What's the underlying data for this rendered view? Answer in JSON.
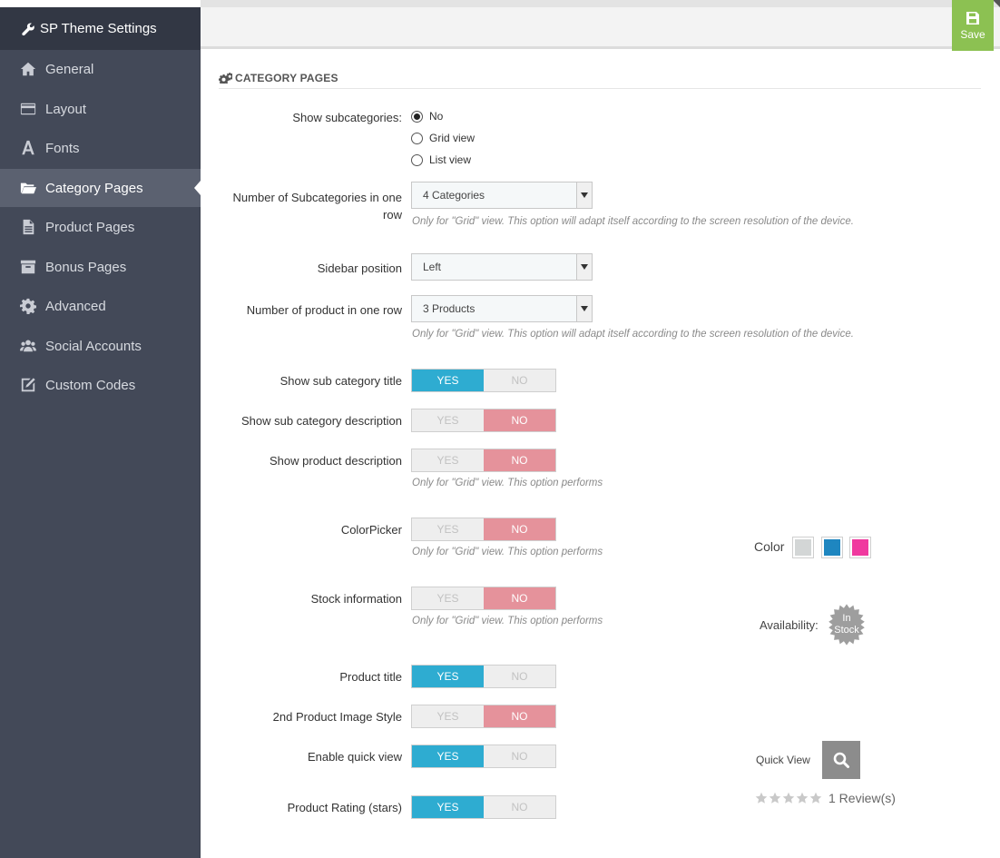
{
  "sidebar": {
    "title": "SP Theme Settings",
    "items": [
      {
        "label": "General",
        "icon": "home-icon"
      },
      {
        "label": "Layout",
        "icon": "credit-card-icon"
      },
      {
        "label": "Fonts",
        "icon": "font-icon"
      },
      {
        "label": "Category Pages",
        "icon": "folder-open-icon",
        "active": true
      },
      {
        "label": "Product Pages",
        "icon": "file-text-icon"
      },
      {
        "label": "Bonus Pages",
        "icon": "archive-icon"
      },
      {
        "label": "Advanced",
        "icon": "gear-icon"
      },
      {
        "label": "Social Accounts",
        "icon": "users-icon"
      },
      {
        "label": "Custom Codes",
        "icon": "edit-icon"
      }
    ]
  },
  "toolbar": {
    "save_label": "Save",
    "accent": "#8cc152"
  },
  "section": {
    "title": "CATEGORY PAGES"
  },
  "form": {
    "show_subcategories": {
      "label": "Show subcategories:",
      "options": [
        "No",
        "Grid view",
        "List view"
      ],
      "selected": "No"
    },
    "num_subcategories": {
      "label": "Number of Subcategories in one row",
      "value": "4 Categories",
      "hint": "Only for \"Grid\" view. This option will adapt itself according to the screen resolution of the device."
    },
    "sidebar_position": {
      "label": "Sidebar position",
      "value": "Left"
    },
    "num_products": {
      "label": "Number of product in one row",
      "value": "3 Products",
      "hint": "Only for \"Grid\" view. This option will adapt itself according to the screen resolution of the device."
    },
    "toggles_text": {
      "yes": "YES",
      "no": "NO"
    },
    "show_subcat_title": {
      "label": "Show sub category title",
      "value": "YES"
    },
    "show_subcat_desc": {
      "label": "Show sub category description",
      "value": "NO"
    },
    "show_product_desc": {
      "label": "Show product description",
      "value": "NO",
      "hint": "Only for \"Grid\" view. This option performs"
    },
    "colorpicker": {
      "label": "ColorPicker",
      "value": "NO",
      "hint": "Only for \"Grid\" view. This option performs"
    },
    "stock_info": {
      "label": "Stock information",
      "value": "NO",
      "hint": "Only for \"Grid\" view. This option performs"
    },
    "product_title": {
      "label": "Product title",
      "value": "YES"
    },
    "second_image_style": {
      "label": "2nd Product Image Style",
      "value": "NO"
    },
    "quick_view": {
      "label": "Enable quick view",
      "value": "YES"
    },
    "product_rating": {
      "label": "Product Rating (stars)",
      "value": "YES"
    }
  },
  "previews": {
    "color_label": "Color",
    "swatches": [
      "#d3d6d6",
      "#1e86c0",
      "#f0399f"
    ],
    "availability_label": "Availability:",
    "badge_line1": "In",
    "badge_line2": "Stock",
    "quick_view_label": "Quick View",
    "reviews_text": "1 Review(s)",
    "rating": 0
  },
  "colors": {
    "yes_on": "#2eacd1",
    "no_on": "#e5929b",
    "sidebar": "#434958"
  }
}
